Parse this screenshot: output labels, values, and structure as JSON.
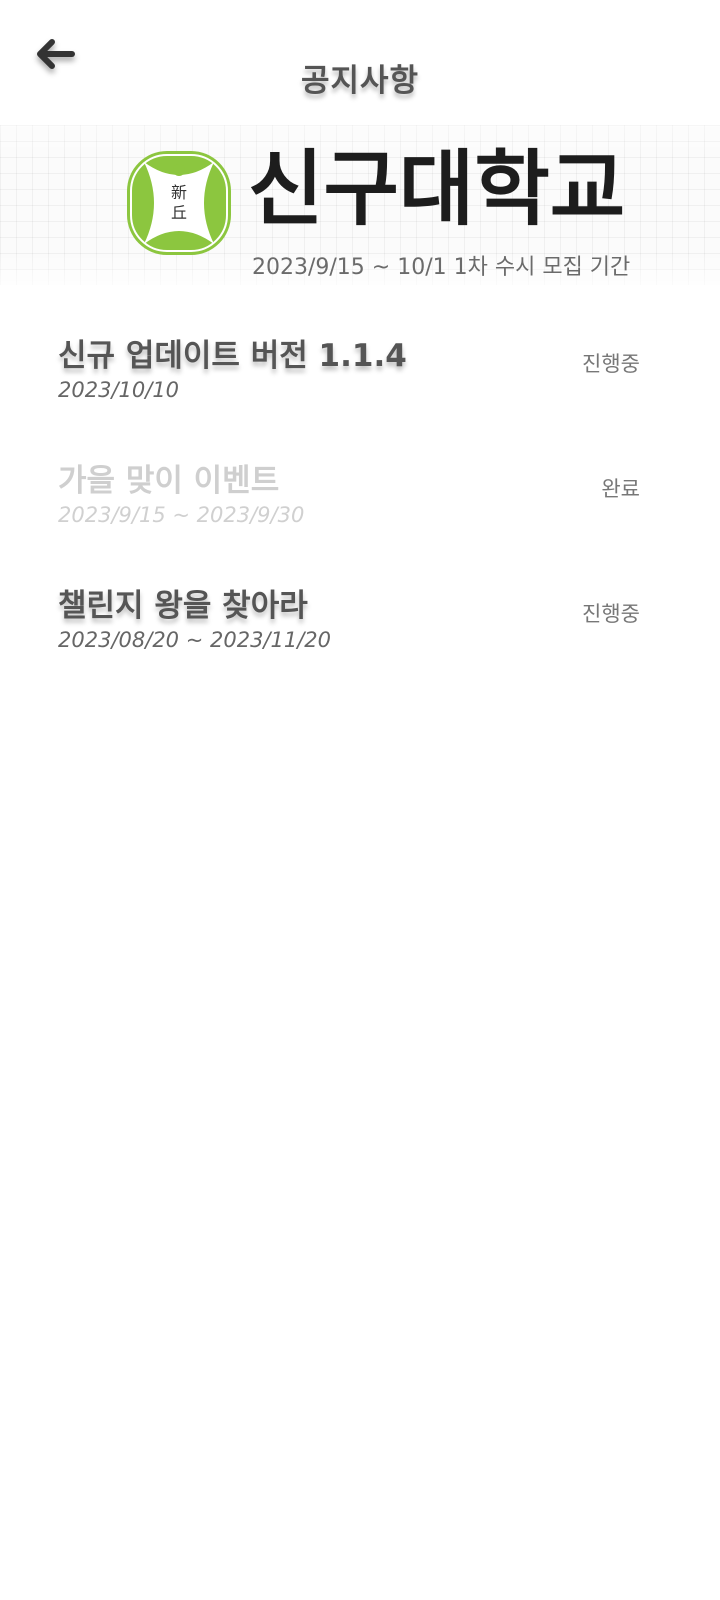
{
  "header": {
    "title": "공지사항",
    "back_icon": "arrow-left-icon"
  },
  "banner": {
    "logo_icon": "university-emblem-icon",
    "logo_chars": [
      "新",
      "丘"
    ],
    "university_name": "신구대학교",
    "caption": "2023/9/15 ~ 10/1 1차 수시 모집 기간",
    "accent_color": "#8cc63f"
  },
  "notices": [
    {
      "title": "신규 업데이트 버전 1.1.4",
      "date": "2023/10/10",
      "status": "진행중",
      "done": false
    },
    {
      "title": "가을 맞이 이벤트",
      "date": "2023/9/15 ~ 2023/9/30",
      "status": "완료",
      "done": true
    },
    {
      "title": "챌린지 왕을 찾아라",
      "date": "2023/08/20 ~ 2023/11/20",
      "status": "진행중",
      "done": false
    }
  ]
}
